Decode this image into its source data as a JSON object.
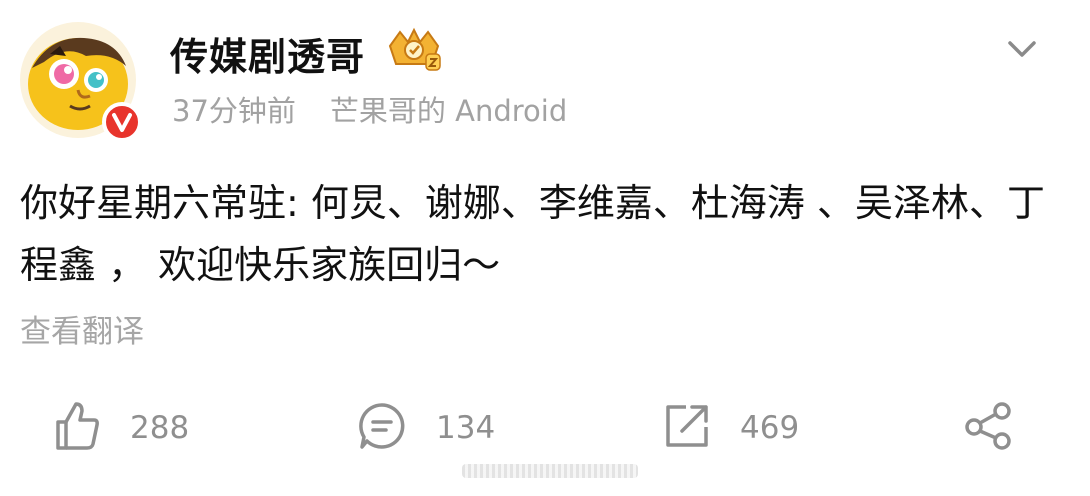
{
  "post": {
    "author": "传媒剧透哥",
    "time": "37分钟前",
    "source": "芒果哥的 Android",
    "content": "你好星期六常驻: 何炅、谢娜、李维嘉、杜海涛 、吴泽林、丁程鑫 ， 欢迎快乐家族回归～",
    "translate_label": "查看翻译"
  },
  "actions": {
    "likes": "288",
    "comments": "134",
    "reposts": "469"
  },
  "colors": {
    "verified": "#e8342c",
    "avatar_face": "#f6c21b",
    "badge_gold": "#e7a52a",
    "muted": "#a2a2a2"
  },
  "icons": [
    "avatar",
    "verified-badge-icon",
    "crown-badge-icon",
    "chevron-down-icon",
    "thumbs-up-icon",
    "comment-icon",
    "repost-icon",
    "share-icon"
  ]
}
